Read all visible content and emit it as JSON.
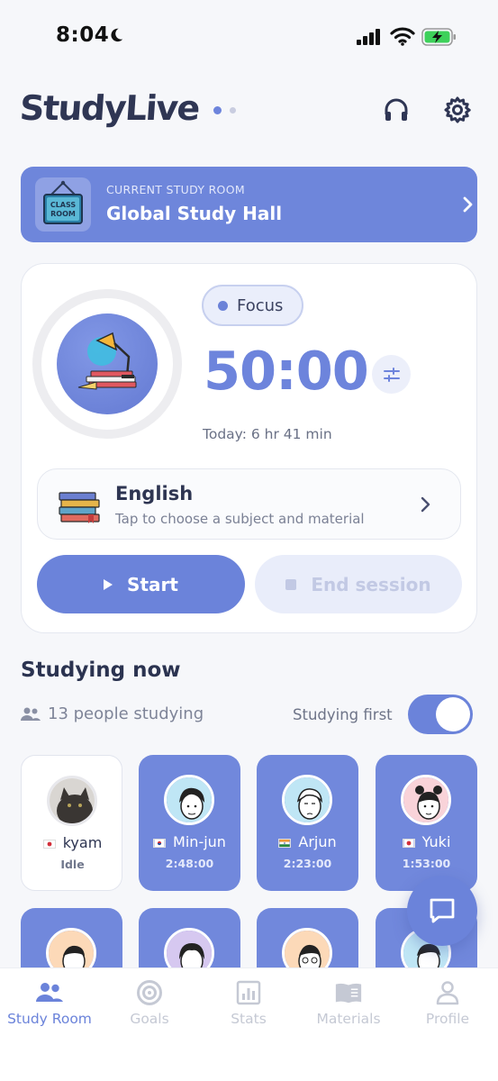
{
  "status_bar": {
    "time": "8:04"
  },
  "header": {
    "app_name": "StudyLive"
  },
  "current_room": {
    "overline": "CURRENT STUDY ROOM",
    "name": "Global Study Hall",
    "sign_text_1": "CLASS",
    "sign_text_2": "ROOM"
  },
  "timer_card": {
    "mode": "Focus",
    "time": "50:00",
    "today": "Today: 6 hr 41 min",
    "subject": {
      "name": "English",
      "hint": "Tap to choose a subject and material"
    },
    "start_label": "Start",
    "end_label": "End session"
  },
  "studying_now": {
    "title": "Studying now",
    "people_count": "13 people studying",
    "sort_label": "Studying first",
    "sort_on": true,
    "users": [
      {
        "name": "kyam",
        "status": "Idle",
        "flag": "JP",
        "state": "idle"
      },
      {
        "name": "Min-jun",
        "status": "2:48:00",
        "flag": "KR",
        "state": "active"
      },
      {
        "name": "Arjun",
        "status": "2:23:00",
        "flag": "IN",
        "state": "active"
      },
      {
        "name": "Yuki",
        "status": "1:53:00",
        "flag": "JP",
        "state": "active"
      }
    ]
  },
  "tabs": [
    {
      "label": "Study Room",
      "icon": "people-icon",
      "active": true
    },
    {
      "label": "Goals",
      "icon": "target-icon",
      "active": false
    },
    {
      "label": "Stats",
      "icon": "bar-chart-icon",
      "active": false
    },
    {
      "label": "Materials",
      "icon": "book-icon",
      "active": false
    },
    {
      "label": "Profile",
      "icon": "person-icon",
      "active": false
    }
  ],
  "colors": {
    "accent": "#6d84dc",
    "accent_light": "#eaeefb",
    "text_dark": "#2b3350"
  }
}
